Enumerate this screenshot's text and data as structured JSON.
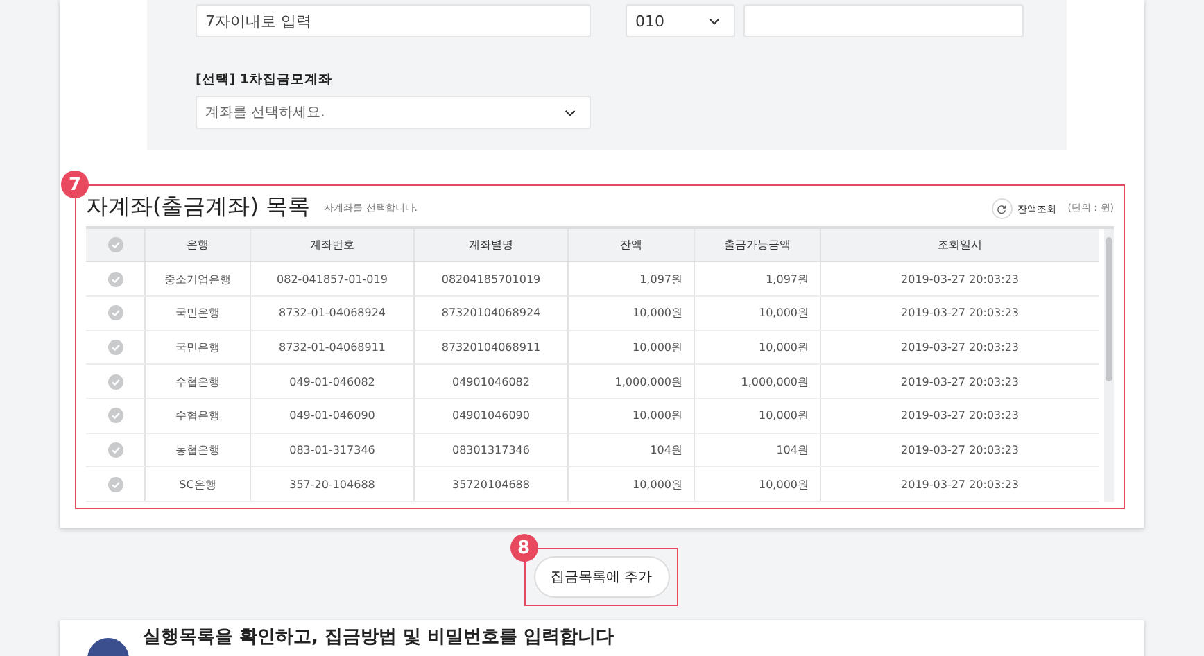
{
  "top_form": {
    "name_field": {
      "placeholder": "7자이내로 입력"
    },
    "phone_prefix": {
      "value": "010"
    },
    "account_select": {
      "label": "[선택] 1차집금모계좌",
      "placeholder": "계좌를 선택하세요."
    }
  },
  "sub_accounts": {
    "step": "7",
    "title": "자계좌(출금계좌) 목록",
    "hint": "자계좌를 선택합니다.",
    "refresh_label": "잔액조회",
    "unit": "(단위 : 원)",
    "all_selected": false,
    "columns": [
      "은행",
      "계좌번호",
      "계좌별명",
      "잔액",
      "출금가능금액",
      "조회일시"
    ],
    "rows": [
      {
        "selected": false,
        "cells": [
          "중소기업은행",
          "082-041857-01-019",
          "08204185701019",
          "1,097원",
          "1,097원",
          "2019-03-27 20:03:23"
        ]
      },
      {
        "selected": false,
        "cells": [
          "국민은행",
          "8732-01-04068924",
          "87320104068924",
          "10,000원",
          "10,000원",
          "2019-03-27 20:03:23"
        ]
      },
      {
        "selected": false,
        "cells": [
          "국민은행",
          "8732-01-04068911",
          "87320104068911",
          "10,000원",
          "10,000원",
          "2019-03-27 20:03:23"
        ]
      },
      {
        "selected": false,
        "cells": [
          "수협은행",
          "049-01-046082",
          "04901046082",
          "1,000,000원",
          "1,000,000원",
          "2019-03-27 20:03:23"
        ]
      },
      {
        "selected": false,
        "cells": [
          "수협은행",
          "049-01-046090",
          "04901046090",
          "10,000원",
          "10,000원",
          "2019-03-27 20:03:23"
        ]
      },
      {
        "selected": false,
        "cells": [
          "농협은행",
          "083-01-317346",
          "08301317346",
          "104원",
          "104원",
          "2019-03-27 20:03:23"
        ]
      },
      {
        "selected": false,
        "cells": [
          "SC은행",
          "357-20-104688",
          "35720104688",
          "10,000원",
          "10,000원",
          "2019-03-27 20:03:23"
        ]
      }
    ]
  },
  "add_button": {
    "step": "8",
    "label": "집금목록에 추가"
  },
  "next_section": {
    "title": "실행목록을 확인하고, 집금방법 및 비밀번호를 입력합니다"
  }
}
